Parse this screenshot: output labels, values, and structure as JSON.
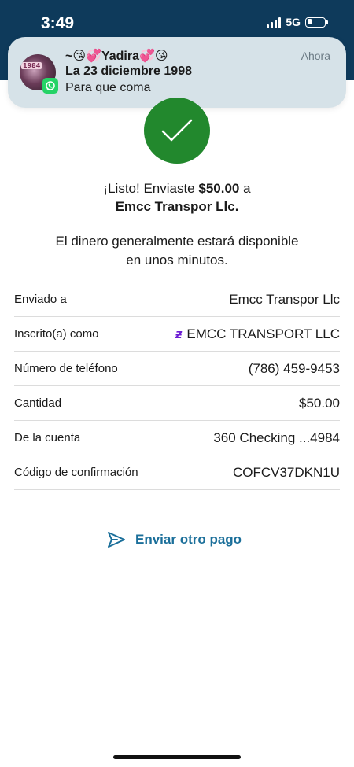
{
  "status_bar": {
    "time": "3:49",
    "network": "5G"
  },
  "notification": {
    "sender": "~😘💞Yadira💞😘",
    "title": "La 23 diciembre 1998",
    "body": "Para que coma",
    "time": "Ahora",
    "avatar_text": "1984",
    "app_icon": "whatsapp-icon"
  },
  "confirmation": {
    "prefix": "¡Listo! Enviaste ",
    "amount": "$50.00",
    "suffix": " a",
    "recipient": "Emcc Transpor Llc.",
    "availability_line1": "El dinero generalmente estará disponible",
    "availability_line2": "en unos minutos."
  },
  "details": [
    {
      "label": "Enviado a",
      "value": "Emcc Transpor Llc"
    },
    {
      "label": "Inscrito(a) como",
      "value": "EMCC TRANSPORT LLC",
      "icon": "zelle-icon"
    },
    {
      "label": "Número de teléfono",
      "value": "(786) 459-9453"
    },
    {
      "label": "Cantidad",
      "value": "$50.00"
    },
    {
      "label": "De la cuenta",
      "value": "360 Checking ...4984"
    },
    {
      "label": "Código de confirmación",
      "value": "COFCV37DKN1U"
    }
  ],
  "actions": {
    "send_again": "Enviar otro pago"
  },
  "colors": {
    "header": "#0e3a5b",
    "success": "#22882d",
    "link": "#1b6f9a",
    "zelle": "#6d1ed4"
  }
}
